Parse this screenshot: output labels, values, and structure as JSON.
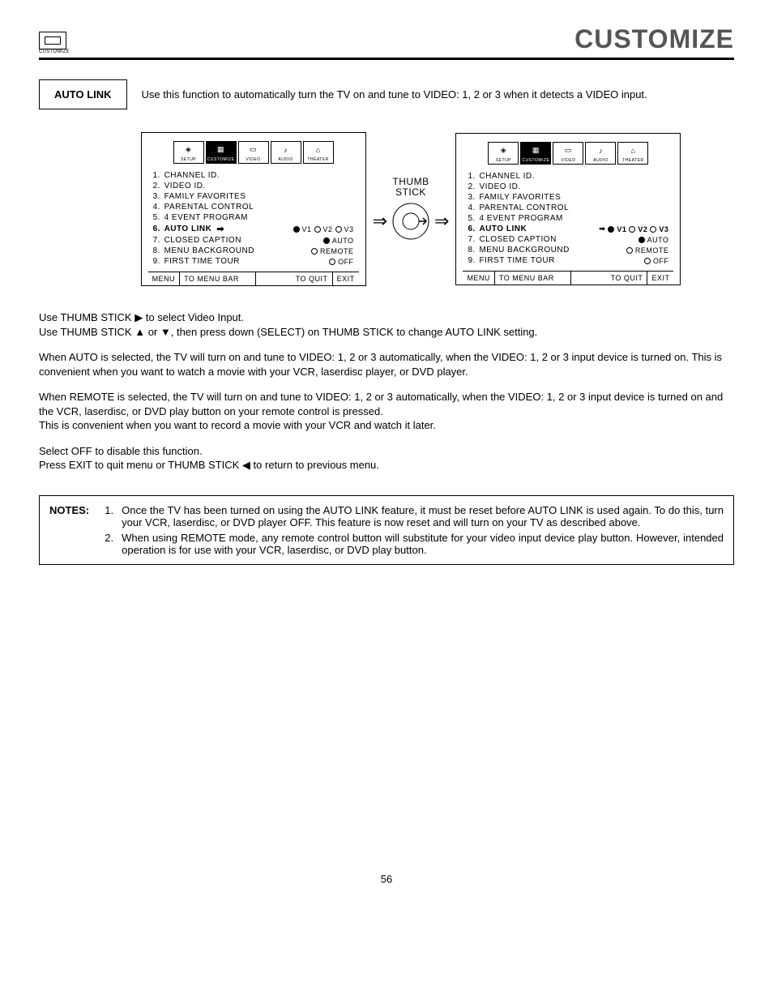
{
  "header": {
    "icon_label": "CUSTOMIZE",
    "title": "CUSTOMIZE"
  },
  "section": {
    "label": "AUTO LINK",
    "desc": "Use this function to automatically turn the TV on and tune to VIDEO: 1, 2 or 3 when it detects a VIDEO input."
  },
  "tabs": [
    "SETUP",
    "CUSTOMIZE",
    "VIDEO",
    "AUDIO",
    "THEATER"
  ],
  "thumbstick_label": "THUMB\nSTICK",
  "screen_left": {
    "items": [
      {
        "n": "1.",
        "l": "CHANNEL ID."
      },
      {
        "n": "2.",
        "l": "VIDEO ID."
      },
      {
        "n": "3.",
        "l": "FAMILY FAVORITES"
      },
      {
        "n": "4.",
        "l": "PARENTAL CONTROL"
      },
      {
        "n": "5.",
        "l": "4 EVENT PROGRAM"
      },
      {
        "n": "6.",
        "l": "AUTO LINK",
        "bold": true,
        "arrow": true,
        "opts": [
          {
            "t": "V1",
            "f": true
          },
          {
            "t": "V2",
            "f": false
          },
          {
            "t": "V3",
            "f": false
          }
        ]
      },
      {
        "n": "7.",
        "l": "CLOSED CAPTION",
        "opts": [
          {
            "t": "AUTO",
            "f": true
          }
        ]
      },
      {
        "n": "8.",
        "l": "MENU BACKGROUND",
        "opts": [
          {
            "t": "REMOTE",
            "f": false
          }
        ]
      },
      {
        "n": "9.",
        "l": "FIRST TIME TOUR",
        "opts": [
          {
            "t": "OFF",
            "f": false
          }
        ]
      }
    ],
    "footer": {
      "menu": "MENU",
      "bar": "TO MENU BAR",
      "quit": "TO QUIT",
      "exit": "EXIT"
    }
  },
  "screen_right": {
    "items": [
      {
        "n": "1.",
        "l": "CHANNEL ID."
      },
      {
        "n": "2.",
        "l": "VIDEO ID."
      },
      {
        "n": "3.",
        "l": "FAMILY FAVORITES"
      },
      {
        "n": "4.",
        "l": "PARENTAL CONTROL"
      },
      {
        "n": "5.",
        "l": "4 EVENT PROGRAM"
      },
      {
        "n": "6.",
        "l": "AUTO LINK",
        "bold": true,
        "leadarrow": true,
        "opts": [
          {
            "t": "V1",
            "f": true
          },
          {
            "t": "V2",
            "f": false
          },
          {
            "t": "V3",
            "f": false
          }
        ],
        "boldopts": true
      },
      {
        "n": "7.",
        "l": "CLOSED CAPTION",
        "opts": [
          {
            "t": "AUTO",
            "f": true
          }
        ]
      },
      {
        "n": "8.",
        "l": "MENU BACKGROUND",
        "opts": [
          {
            "t": "REMOTE",
            "f": false
          }
        ]
      },
      {
        "n": "9.",
        "l": "FIRST TIME TOUR",
        "opts": [
          {
            "t": "OFF",
            "f": false
          }
        ]
      }
    ],
    "footer": {
      "menu": "MENU",
      "bar": "TO MENU BAR",
      "quit": "TO QUIT",
      "exit": "EXIT"
    }
  },
  "body": {
    "p1a": "Use THUMB STICK ▶ to select Video Input.",
    "p1b": "Use THUMB STICK ▲ or ▼, then press down (SELECT) on THUMB STICK to change AUTO LINK setting.",
    "p2": "When AUTO is selected, the TV will turn on and tune to VIDEO: 1, 2 or 3 automatically, when the VIDEO: 1, 2 or 3 input device is turned on. This is convenient when you want to watch a movie with your VCR, laserdisc player, or DVD player.",
    "p3": "When REMOTE is selected, the TV will turn on and tune to VIDEO: 1, 2 or 3 automatically, when the VIDEO: 1, 2 or 3 input device is turned on and the VCR, laserdisc, or DVD play button on your remote control is pressed.\nThis is convenient when you want to record a movie with your VCR and watch it later.",
    "p4a": "Select OFF to disable this function.",
    "p4b": "Press EXIT to quit menu or THUMB STICK ◀ to return to previous menu."
  },
  "notes": {
    "label": "NOTES:",
    "items": [
      {
        "n": "1.",
        "t": "Once the TV has been turned on using the AUTO LINK feature, it must be reset before AUTO LINK is used again. To do this, turn your VCR, laserdisc, or DVD player OFF. This feature is now reset and will turn on your TV as described above."
      },
      {
        "n": "2.",
        "t": "When using REMOTE mode, any remote control button will substitute for your video input device play button. However, intended operation is for use with your VCR, laserdisc, or DVD play button."
      }
    ]
  },
  "page_number": "56"
}
